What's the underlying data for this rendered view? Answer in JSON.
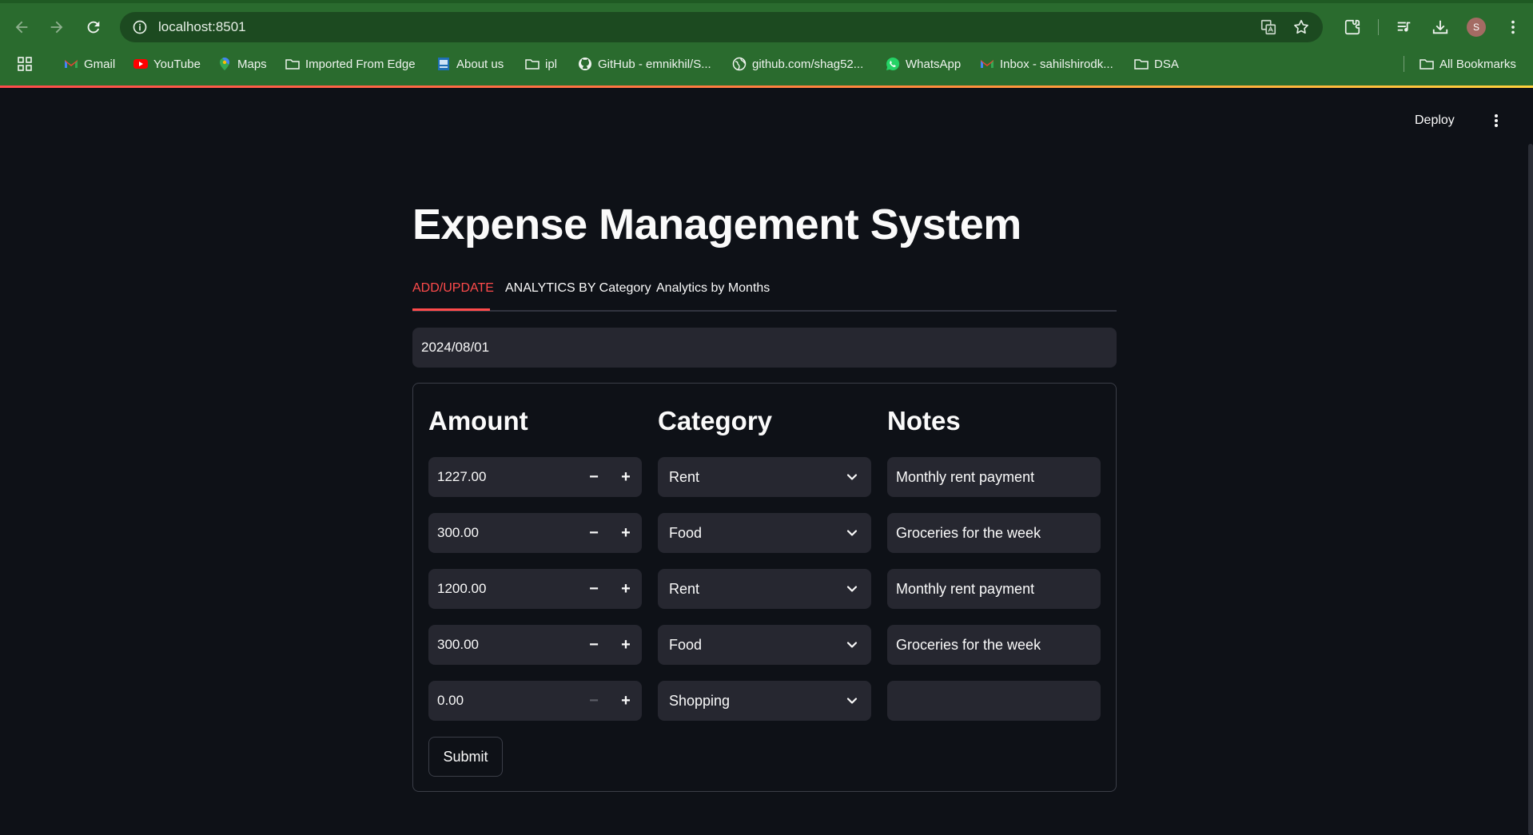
{
  "browser": {
    "url": "localhost:8501",
    "profile_initial": "S",
    "bookmarks": [
      {
        "label": "Gmail",
        "icon": "gmail-icon"
      },
      {
        "label": "YouTube",
        "icon": "youtube-icon"
      },
      {
        "label": "Maps",
        "icon": "maps-icon"
      },
      {
        "label": "Imported From Edge",
        "icon": "folder-icon"
      },
      {
        "label": "About us",
        "icon": "page-icon"
      },
      {
        "label": "ipl",
        "icon": "folder-icon"
      },
      {
        "label": "GitHub - emnikhil/S...",
        "icon": "github-icon"
      },
      {
        "label": "github.com/shag52...",
        "icon": "globe-icon"
      },
      {
        "label": "WhatsApp",
        "icon": "whatsapp-icon"
      },
      {
        "label": "Inbox - sahilshirodk...",
        "icon": "gmail-icon"
      },
      {
        "label": "DSA",
        "icon": "folder-icon"
      }
    ],
    "all_bookmarks": "All Bookmarks",
    "colors": {
      "chrome": "#2a6b2e",
      "omnibox": "#1c4a20"
    }
  },
  "app": {
    "deploy_label": "Deploy",
    "title": "Expense Management System",
    "tabs": [
      {
        "label": "ADD/UPDATE",
        "active": true
      },
      {
        "label": "ANALYTICS BY Category",
        "active": false
      },
      {
        "label": "Analytics by Months",
        "active": false
      }
    ],
    "date_value": "2024/08/01",
    "columns": {
      "amount": "Amount",
      "category": "Category",
      "notes": "Notes"
    },
    "rows": [
      {
        "amount": "1227.00",
        "category": "Rent",
        "notes": "Monthly rent payment"
      },
      {
        "amount": "300.00",
        "category": "Food",
        "notes": "Groceries for the week"
      },
      {
        "amount": "1200.00",
        "category": "Rent",
        "notes": "Monthly rent payment"
      },
      {
        "amount": "300.00",
        "category": "Food",
        "notes": "Groceries for the week"
      },
      {
        "amount": "0.00",
        "category": "Shopping",
        "notes": ""
      }
    ],
    "stepper": {
      "minus": "−",
      "plus": "+"
    },
    "submit_label": "Submit",
    "colors": {
      "accent": "#ff4b4b",
      "background": "#0e1117",
      "input": "#262730"
    }
  }
}
